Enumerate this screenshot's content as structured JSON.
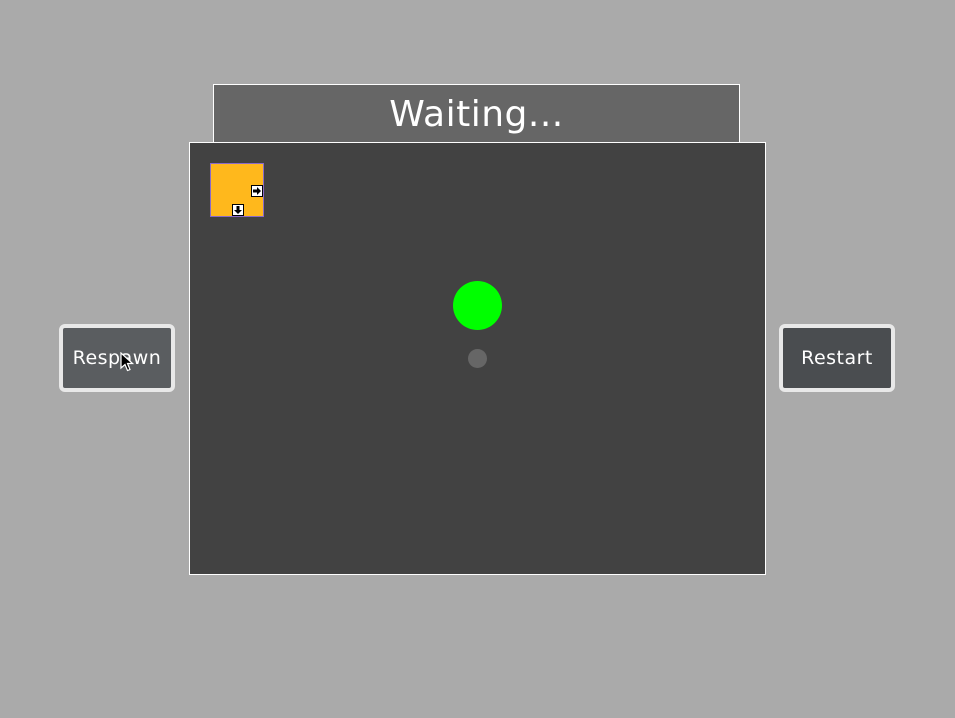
{
  "status": {
    "text": "Waiting..."
  },
  "buttons": {
    "respawn_label": "Respawn",
    "restart_label": "Restart"
  },
  "game": {
    "player_block": {
      "color": "#ffb81c",
      "keys": [
        "arrow-right-icon",
        "arrow-down-icon"
      ]
    },
    "goal": {
      "color": "#00ff00"
    },
    "spawn_marker": {
      "color": "#666666"
    }
  },
  "colors": {
    "background": "#aaaaaa",
    "arena": "#424242",
    "status_bar": "#666666"
  }
}
